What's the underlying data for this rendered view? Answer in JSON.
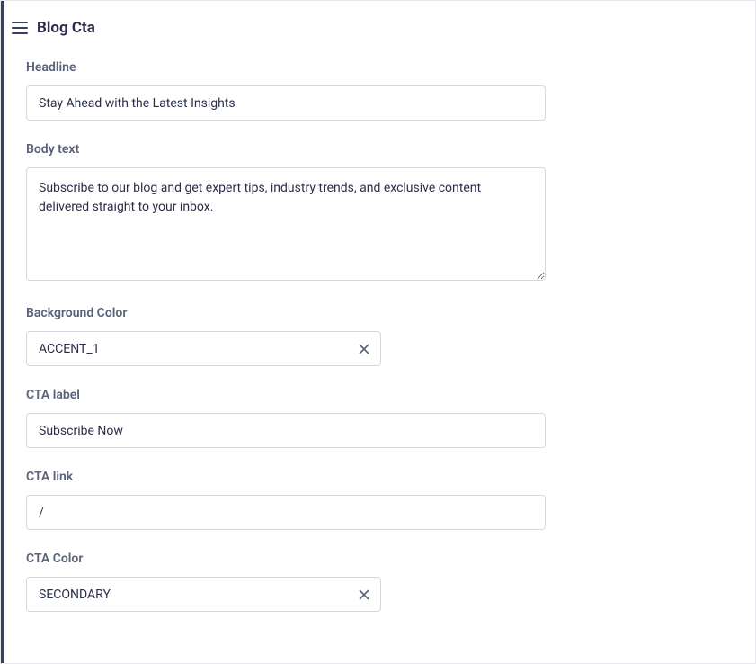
{
  "header": {
    "title": "Blog Cta"
  },
  "fields": {
    "headline": {
      "label": "Headline",
      "value": "Stay Ahead with the Latest Insights"
    },
    "bodyText": {
      "label": "Body text",
      "value": "Subscribe to our blog and get expert tips, industry trends, and exclusive content delivered straight to your inbox."
    },
    "backgroundColor": {
      "label": "Background Color",
      "value": "ACCENT_1"
    },
    "ctaLabel": {
      "label": "CTA label",
      "value": "Subscribe Now"
    },
    "ctaLink": {
      "label": "CTA link",
      "value": "/"
    },
    "ctaColor": {
      "label": "CTA Color",
      "value": "SECONDARY"
    }
  }
}
